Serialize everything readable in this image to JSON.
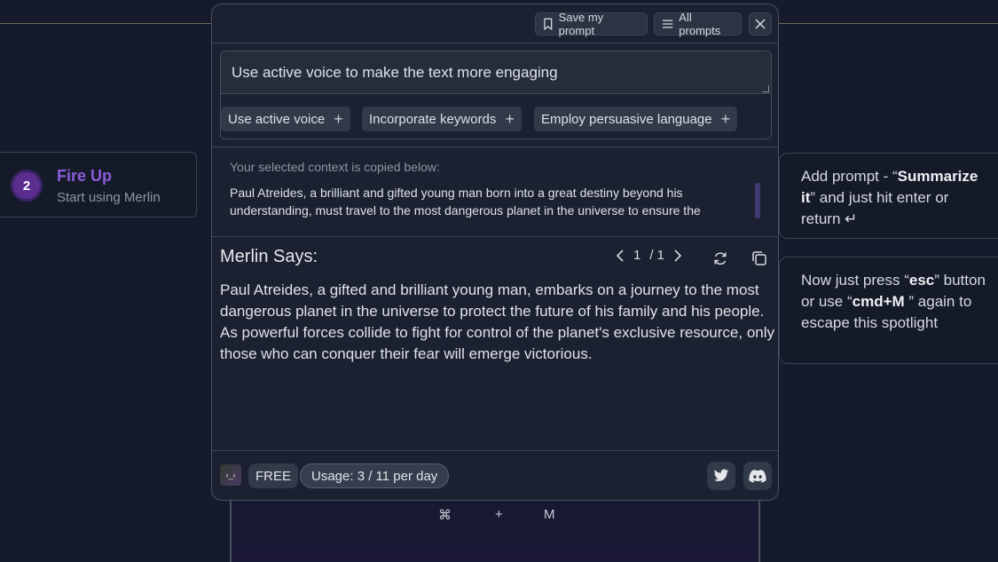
{
  "colors": {
    "background": "#151b2a",
    "modal_bg": "#1b2130",
    "accent_purple": "#8c5bd9",
    "chip_bg": "#323949"
  },
  "step": {
    "number": "2",
    "title": "Fire Up",
    "subtitle": "Start using Merlin"
  },
  "hints": [
    {
      "pre": "Add prompt - “",
      "bold": "Summarize it",
      "post": "” and just hit enter or return ↵"
    },
    {
      "pre": "Now just press “",
      "bold": "esc",
      "mid": "” button or use “",
      "bold2": "cmd+M",
      "post": " ” again to escape this spotlight"
    }
  ],
  "shortcut": {
    "cmd": "⌘",
    "plus": "+",
    "key": "M"
  },
  "modal": {
    "toolbar": {
      "save_prompt_label": "Save my prompt",
      "all_prompts_label": "All prompts",
      "close_icon": "close-icon"
    },
    "prompt": {
      "value": "Use active voice to make the text more engaging",
      "chips": [
        "Use active voice",
        "Incorporate keywords",
        "Employ persuasive language"
      ]
    },
    "context": {
      "label": "Your selected context is copied below:",
      "text": "Paul Atreides, a brilliant and gifted young man born into a great destiny beyond his understanding, must travel to the most dangerous planet in the universe to ensure the"
    },
    "response": {
      "title": "Merlin Says:",
      "page_current": "1",
      "page_total": "/ 1",
      "text": "Paul Atreides, a gifted and brilliant young man, embarks on a journey to the most dangerous planet in the universe to protect the future of his family and his people. As powerful forces collide to fight for control of the planet's exclusive resource, only those who can conquer their fear will emerge victorious."
    },
    "footer": {
      "logo_text": "›_‹",
      "plan": "FREE",
      "usage": "Usage: 3 / 11 per day"
    }
  }
}
